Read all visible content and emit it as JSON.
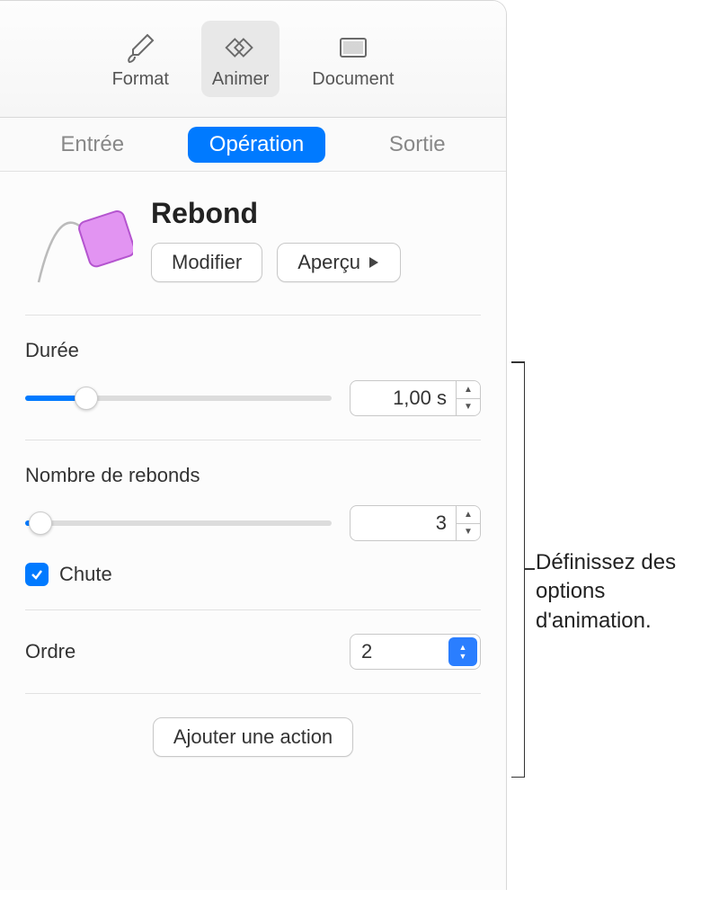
{
  "toolbar": {
    "format": "Format",
    "animate": "Animer",
    "document": "Document"
  },
  "tabs": {
    "in": "Entrée",
    "action": "Opération",
    "out": "Sortie"
  },
  "effect": {
    "title": "Rebond",
    "modify": "Modifier",
    "preview": "Aperçu"
  },
  "duration": {
    "label": "Durée",
    "value": "1,00 s",
    "slider_pct": 20
  },
  "bounces": {
    "label": "Nombre de rebonds",
    "value": "3",
    "slider_pct": 5,
    "checkbox_label": "Chute",
    "checkbox_checked": true
  },
  "order": {
    "label": "Ordre",
    "value": "2"
  },
  "add_action": "Ajouter une action",
  "callout": "Définissez des options d'animation."
}
